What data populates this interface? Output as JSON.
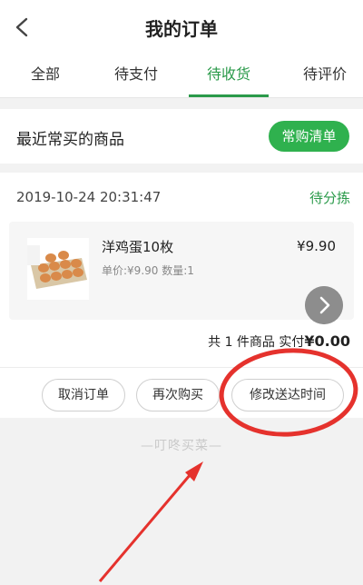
{
  "header": {
    "title": "我的订单"
  },
  "tabs": [
    {
      "label": "全部"
    },
    {
      "label": "待支付"
    },
    {
      "label": "待收货"
    },
    {
      "label": "待评价"
    }
  ],
  "frequent": {
    "label": "最近常买的商品",
    "button": "常购清单"
  },
  "order": {
    "time": "2019-10-24 20:31:47",
    "status": "待分拣",
    "product": {
      "name": "洋鸡蛋10枚",
      "meta": "单价:¥9.90 数量:1",
      "price": "¥9.90"
    },
    "summary_prefix": "共 1 件商品  实付",
    "summary_amount": "¥0.00",
    "buttons": {
      "cancel": "取消订单",
      "rebuy": "再次购买",
      "modify_time": "修改送达时间"
    }
  },
  "brand": "—叮咚买菜—",
  "colors": {
    "accent": "#2a9a4a",
    "button_green": "#2fb14e",
    "annotation_red": "#e5322d"
  }
}
